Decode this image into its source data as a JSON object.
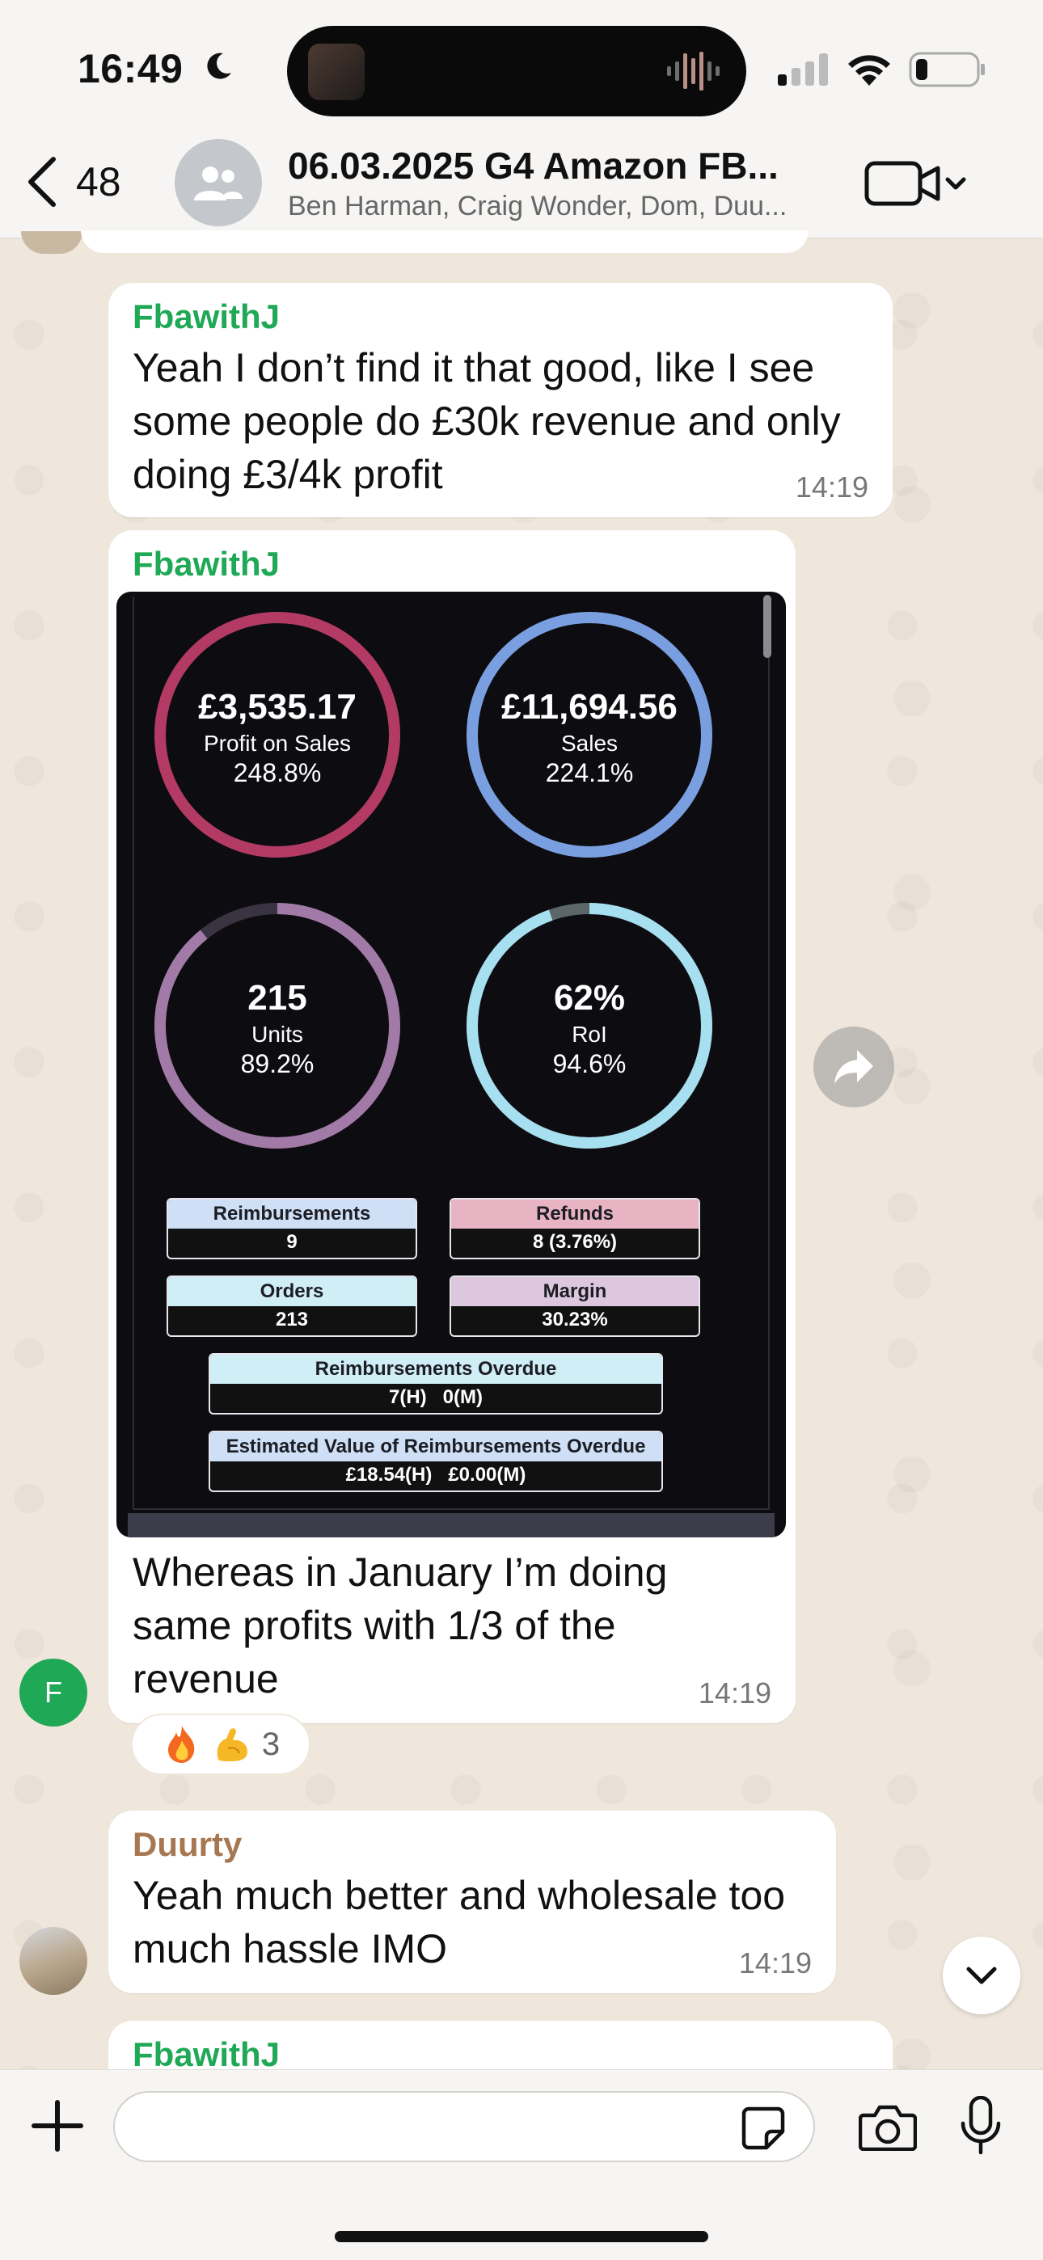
{
  "status_bar": {
    "time": "16:49"
  },
  "header": {
    "back_count": "48",
    "title": "06.03.2025 G4 Amazon FB...",
    "subtitle": "Ben Harman, Craig Wonder, Dom, Duu..."
  },
  "messages": [
    {
      "sender": "FbawithJ",
      "text": "Yeah I don’t find it that good, like I see some people do £30k revenue and only doing £3/4k profit",
      "time": "14:19"
    },
    {
      "sender": "FbawithJ",
      "dashboard": {
        "rings": [
          {
            "main": "£3,535.17",
            "label": "Profit on Sales",
            "pct": "248.8%",
            "color": "#b33b63",
            "fill": 1.0
          },
          {
            "main": "£11,694.56",
            "label": "Sales",
            "pct": "224.1%",
            "color": "#7a9fe0",
            "fill": 1.0
          },
          {
            "main": "215",
            "label": "Units",
            "pct": "89.2%",
            "color": "#a27aa8",
            "fill": 0.892
          },
          {
            "main": "62%",
            "label": "RoI",
            "pct": "94.6%",
            "color": "#a6dff0",
            "fill": 0.946
          }
        ],
        "stats": {
          "reimbursements": {
            "label": "Reimbursements",
            "value": "9"
          },
          "refunds": {
            "label": "Refunds",
            "value": "8 (3.76%)"
          },
          "orders": {
            "label": "Orders",
            "value": "213"
          },
          "margin": {
            "label": "Margin",
            "value": "30.23%"
          },
          "reimb_overdue": {
            "label": "Reimbursements Overdue",
            "value": "7(H)   0(M)"
          },
          "est_value": {
            "label": "Estimated Value of Reimbursements Overdue",
            "value": "£18.54(H)   £0.00(M)"
          }
        }
      },
      "text": "Whereas in January I’m doing same profits with 1/3 of the revenue",
      "time": "14:19",
      "avatar_initial": "F",
      "reactions": {
        "count": "3",
        "emojis": [
          "fire-emoji",
          "flexed-biceps-emoji"
        ]
      }
    },
    {
      "sender": "Duurty",
      "text": "Yeah much better and wholesale too much hassle IMO",
      "time": "14:19"
    },
    {
      "sender": "FbawithJ"
    }
  ],
  "composer": {
    "value": ""
  },
  "colors": {
    "sender_green": "#1fa855",
    "sender_brown": "#a67751",
    "bubble": "#ffffff",
    "chat_bg": "#efe7dc"
  }
}
